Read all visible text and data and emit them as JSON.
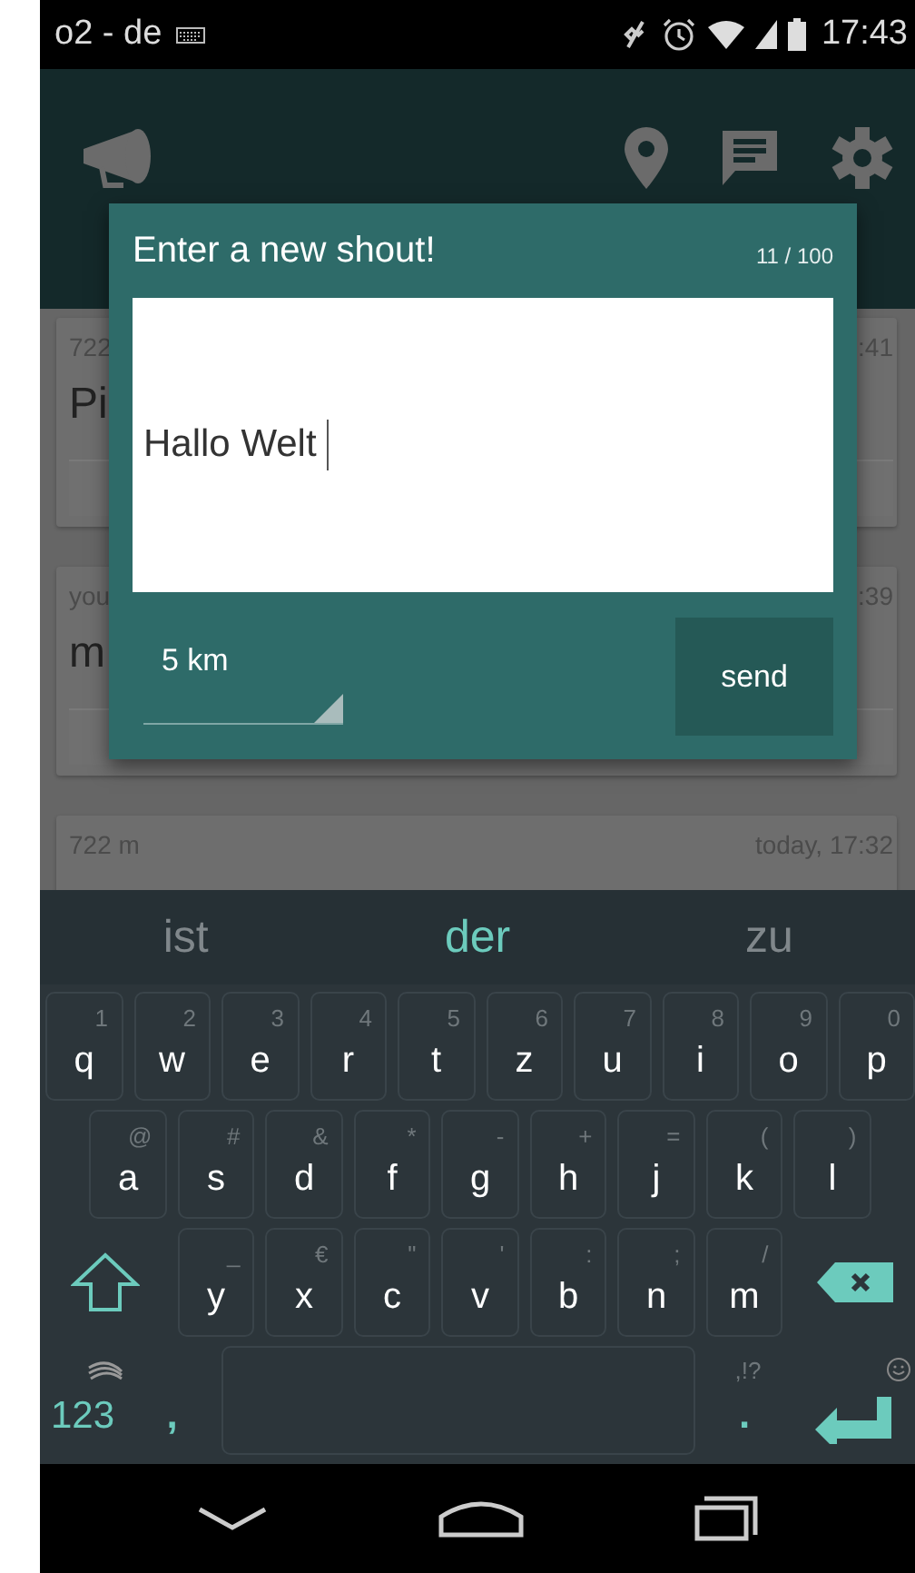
{
  "status_bar": {
    "carrier": "o2 - de",
    "time": "17:43"
  },
  "background_cards": [
    {
      "distance": "722",
      "message": "Pi",
      "time": ":41"
    },
    {
      "distance": "you",
      "message": "m",
      "time": ":39"
    },
    {
      "distance": "722 m",
      "time": "today, 17:32"
    }
  ],
  "dialog": {
    "title": "Enter a new shout!",
    "counter": "11 / 100",
    "message": "Hallo Welt",
    "radius": "5 km",
    "send_button": "send"
  },
  "keyboard": {
    "suggestions": [
      {
        "text": "ist",
        "selected": false
      },
      {
        "text": "der",
        "selected": true
      },
      {
        "text": "zu",
        "selected": false
      }
    ],
    "rows": [
      {
        "keys": [
          {
            "kind": "letter",
            "label": "q",
            "hint": "1"
          },
          {
            "kind": "letter",
            "label": "w",
            "hint": "2"
          },
          {
            "kind": "letter",
            "label": "e",
            "hint": "3"
          },
          {
            "kind": "letter",
            "label": "r",
            "hint": "4"
          },
          {
            "kind": "letter",
            "label": "t",
            "hint": "5"
          },
          {
            "kind": "letter",
            "label": "z",
            "hint": "6"
          },
          {
            "kind": "letter",
            "label": "u",
            "hint": "7"
          },
          {
            "kind": "letter",
            "label": "i",
            "hint": "8"
          },
          {
            "kind": "letter",
            "label": "o",
            "hint": "9"
          },
          {
            "kind": "letter",
            "label": "p",
            "hint": "0"
          }
        ]
      },
      {
        "keys": [
          {
            "kind": "letter",
            "label": "a",
            "hint": "@"
          },
          {
            "kind": "letter",
            "label": "s",
            "hint": "#"
          },
          {
            "kind": "letter",
            "label": "d",
            "hint": "&"
          },
          {
            "kind": "letter",
            "label": "f",
            "hint": "*"
          },
          {
            "kind": "letter",
            "label": "g",
            "hint": "-"
          },
          {
            "kind": "letter",
            "label": "h",
            "hint": "+"
          },
          {
            "kind": "letter",
            "label": "j",
            "hint": "="
          },
          {
            "kind": "letter",
            "label": "k",
            "hint": "("
          },
          {
            "kind": "letter",
            "label": "l",
            "hint": ")"
          }
        ]
      },
      {
        "keys": [
          {
            "kind": "shift"
          },
          {
            "kind": "letter",
            "label": "y",
            "hint": "_"
          },
          {
            "kind": "letter",
            "label": "x",
            "hint": "€"
          },
          {
            "kind": "letter",
            "label": "c",
            "hint": "\""
          },
          {
            "kind": "letter",
            "label": "v",
            "hint": "'"
          },
          {
            "kind": "letter",
            "label": "b",
            "hint": ":"
          },
          {
            "kind": "letter",
            "label": "n",
            "hint": ";"
          },
          {
            "kind": "letter",
            "label": "m",
            "hint": "/"
          },
          {
            "kind": "backspace"
          }
        ]
      },
      {
        "keys": [
          {
            "kind": "symbols",
            "label": "123"
          },
          {
            "kind": "punct",
            "label": ","
          },
          {
            "kind": "space"
          },
          {
            "kind": "punct",
            "label": ".",
            "hint": ",!?"
          },
          {
            "kind": "enter"
          }
        ]
      }
    ]
  }
}
